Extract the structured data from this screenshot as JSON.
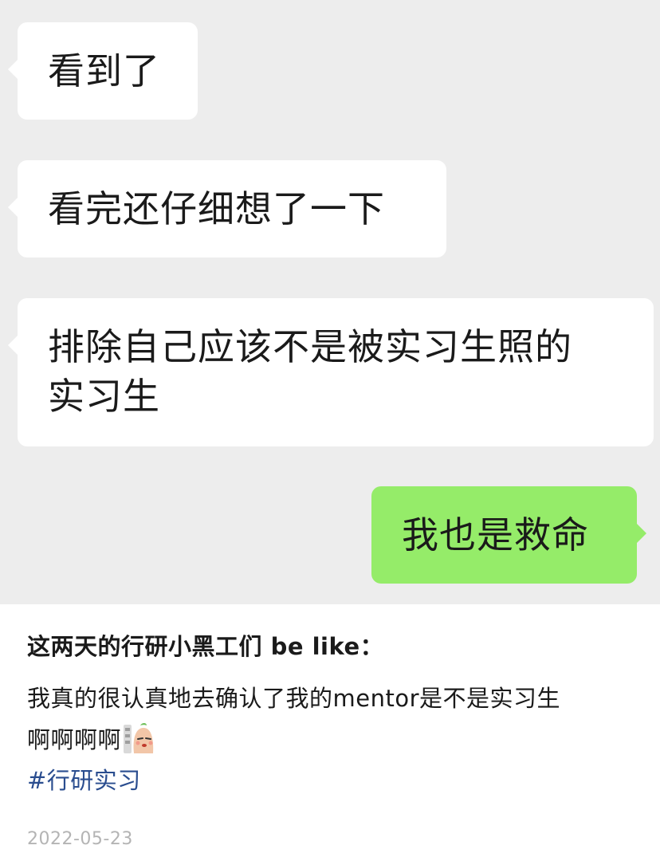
{
  "chat": {
    "messages": [
      {
        "side": "left",
        "text": "看到了"
      },
      {
        "side": "left",
        "text": "看完还仔细想了一下"
      },
      {
        "side": "left",
        "line1": "排除自己应该不是被实习生照的",
        "line2": "实习生"
      },
      {
        "side": "right",
        "text": "我也是救命"
      }
    ]
  },
  "post": {
    "title": "这两天的行研小黑工们 be like：",
    "body_line1": "我真的很认真地去确认了我的mentor是不是实习生",
    "body_line2": "啊啊啊啊",
    "sticker_icon": "sweating-potato-emoji-icon",
    "hashtag": "#行研实习",
    "date": "2022-05-23"
  },
  "colors": {
    "chat_background": "#ededed",
    "bubble_incoming": "#ffffff",
    "bubble_outgoing": "#95ec69",
    "hashtag": "#2a4d8f",
    "date": "#b4b4b4"
  }
}
